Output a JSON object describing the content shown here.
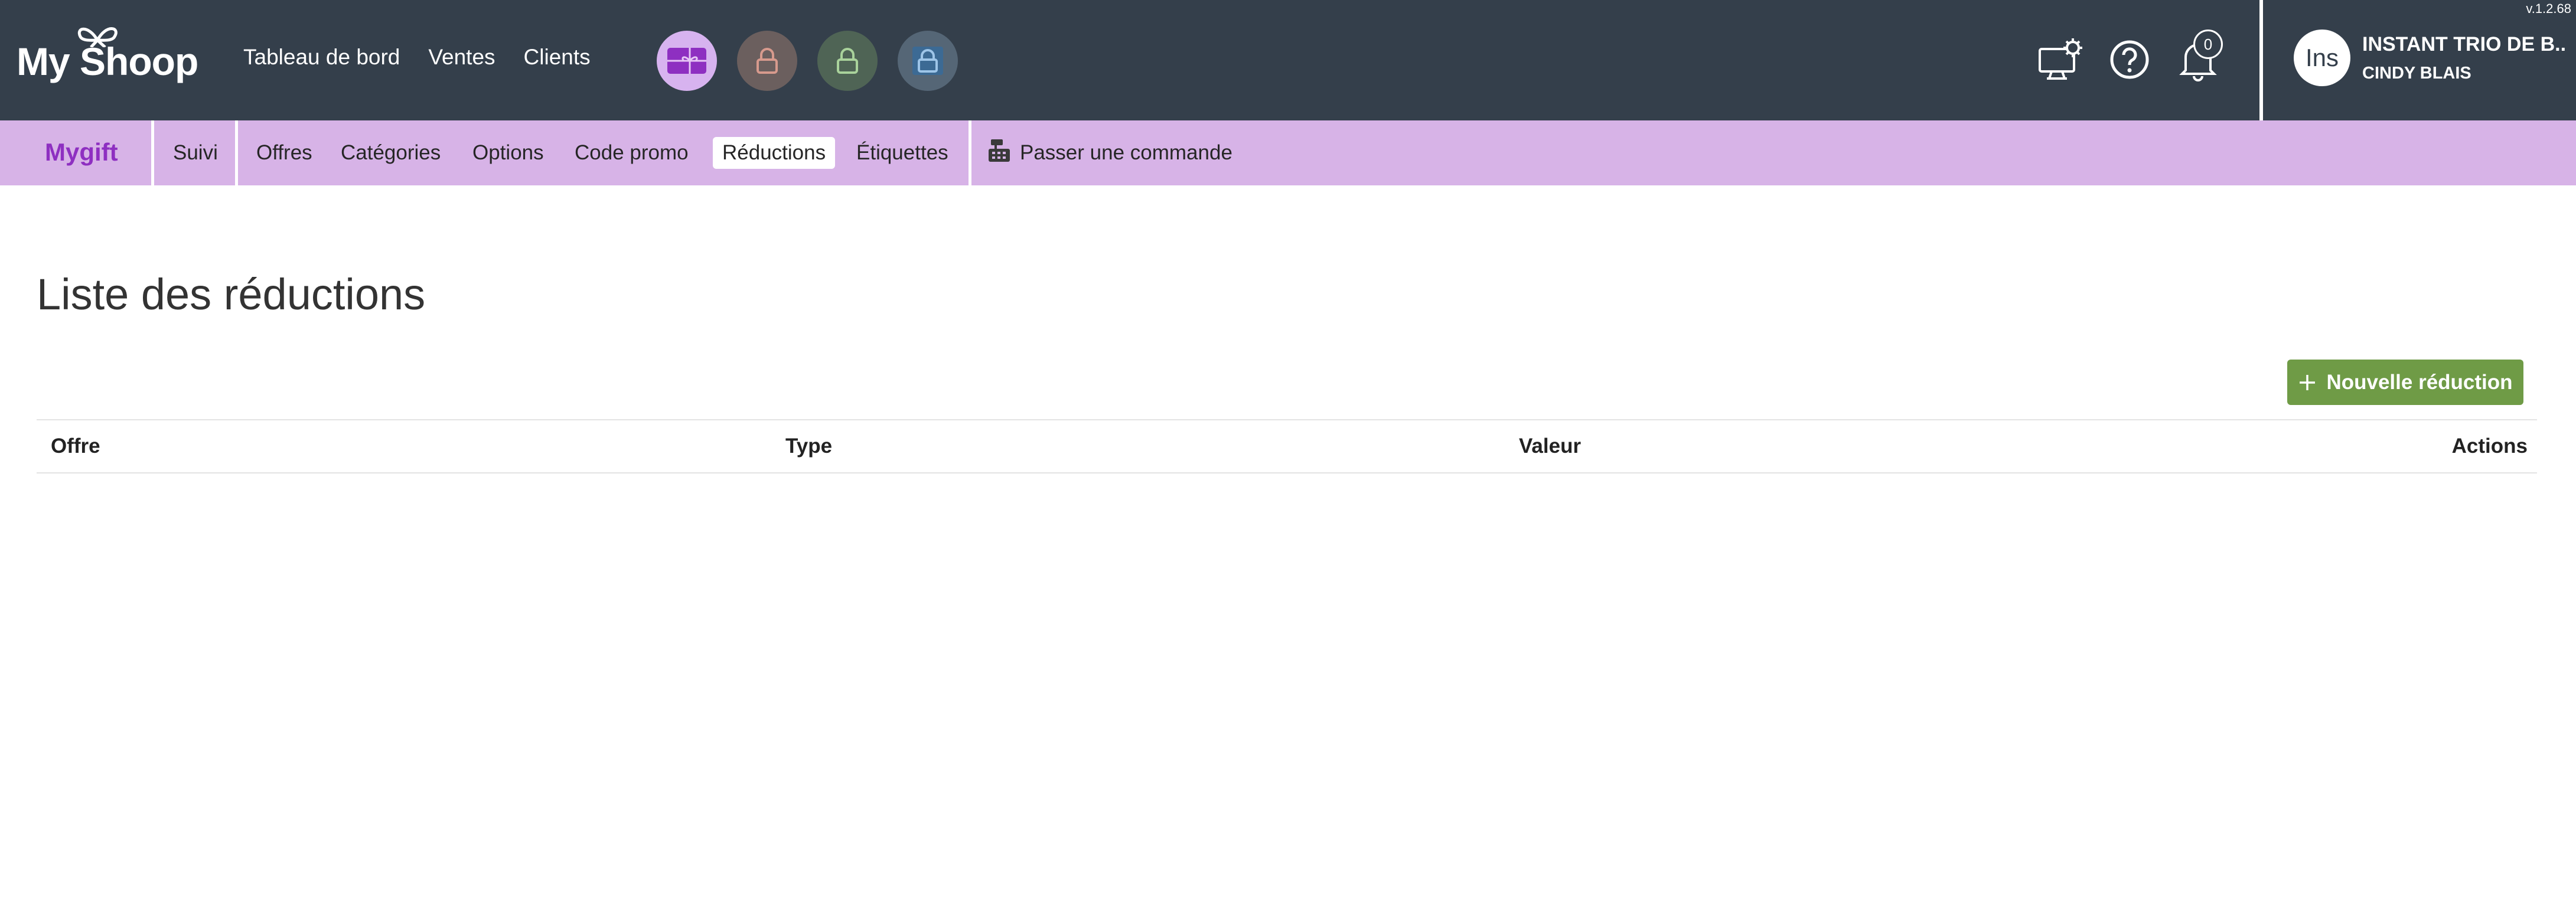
{
  "app": {
    "logo_text": "My Shoop",
    "version": "v.1.2.68"
  },
  "topnav": [
    "Tableau de bord",
    "Ventes",
    "Clients"
  ],
  "app_icons": [
    "gift-icon",
    "lock-icon",
    "lock-icon",
    "lock-icon"
  ],
  "tools": {
    "notification_count": "0"
  },
  "user": {
    "avatar": "Ins",
    "shop_name": "INSTANT TRIO DE B...",
    "user_name": "CINDY BLAIS"
  },
  "subnav": {
    "brand": "Mygift",
    "items": [
      "Suivi",
      "Offres",
      "Catégories",
      "Options",
      "Code promo",
      "Réductions",
      "Étiquettes"
    ],
    "active": "Réductions",
    "order_label": "Passer une commande"
  },
  "main": {
    "title": "Liste des réductions",
    "new_button": "Nouvelle réduction",
    "columns": [
      "Offre",
      "Type",
      "Valeur",
      "Actions"
    ],
    "rows": []
  },
  "colors": {
    "topbar": "#343f4b",
    "subnav": "#d7b3e7",
    "brand": "#8e2fc1",
    "primary_button": "#6f9b46"
  }
}
